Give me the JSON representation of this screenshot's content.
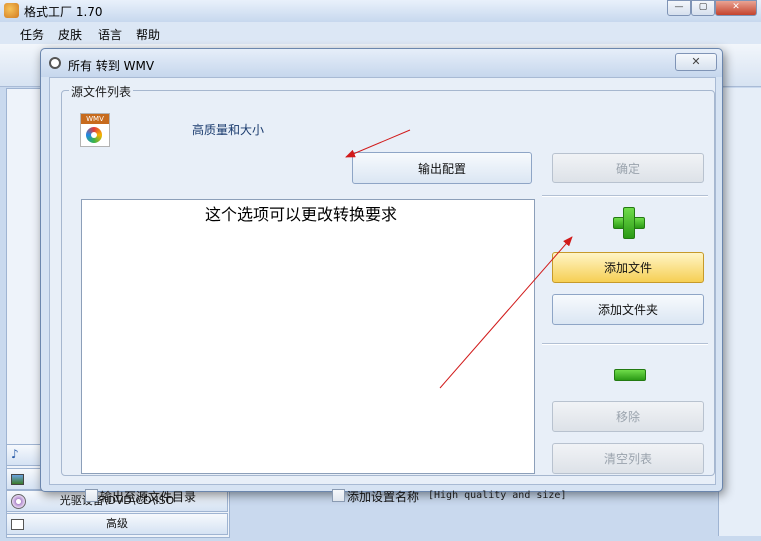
{
  "app": {
    "title": "格式工厂 1.70",
    "menu": [
      "任务",
      "皮肤",
      "语言",
      "帮助"
    ],
    "window_controls": {
      "minimize": "—",
      "maximize": "▢",
      "close": "✕"
    }
  },
  "sidebar": {
    "rows": [
      {
        "label": "",
        "icon": "music-note-icon"
      },
      {
        "label": "",
        "icon": "picture-icon"
      },
      {
        "label": "光驱设备\\DVD\\CD\\ISO",
        "icon": "disc-icon"
      },
      {
        "label": "高级",
        "icon": "advanced-icon"
      }
    ]
  },
  "dialog": {
    "title": "所有 转到 WMV",
    "close_label": "✕",
    "group_label": "源文件列表",
    "preset_icon_text": "WMV",
    "preset_label": "高质量和大小",
    "output_config_label": "输出配置",
    "confirm_label": "确定",
    "add_file_label": "添加文件",
    "add_folder_label": "添加文件夹",
    "remove_label": "移除",
    "clear_list_label": "清空列表",
    "file_list_annotation": "这个选项可以更改转换要求",
    "checkbox_output_dir": "输出至源文件目录",
    "checkbox_preset_name": "添加设置名称",
    "preset_name_value": "[High quality and size]"
  },
  "colors": {
    "annotation_arrow": "#d11a1a",
    "active_button": "#f6cf54",
    "plus_minus": "#3cb524"
  }
}
